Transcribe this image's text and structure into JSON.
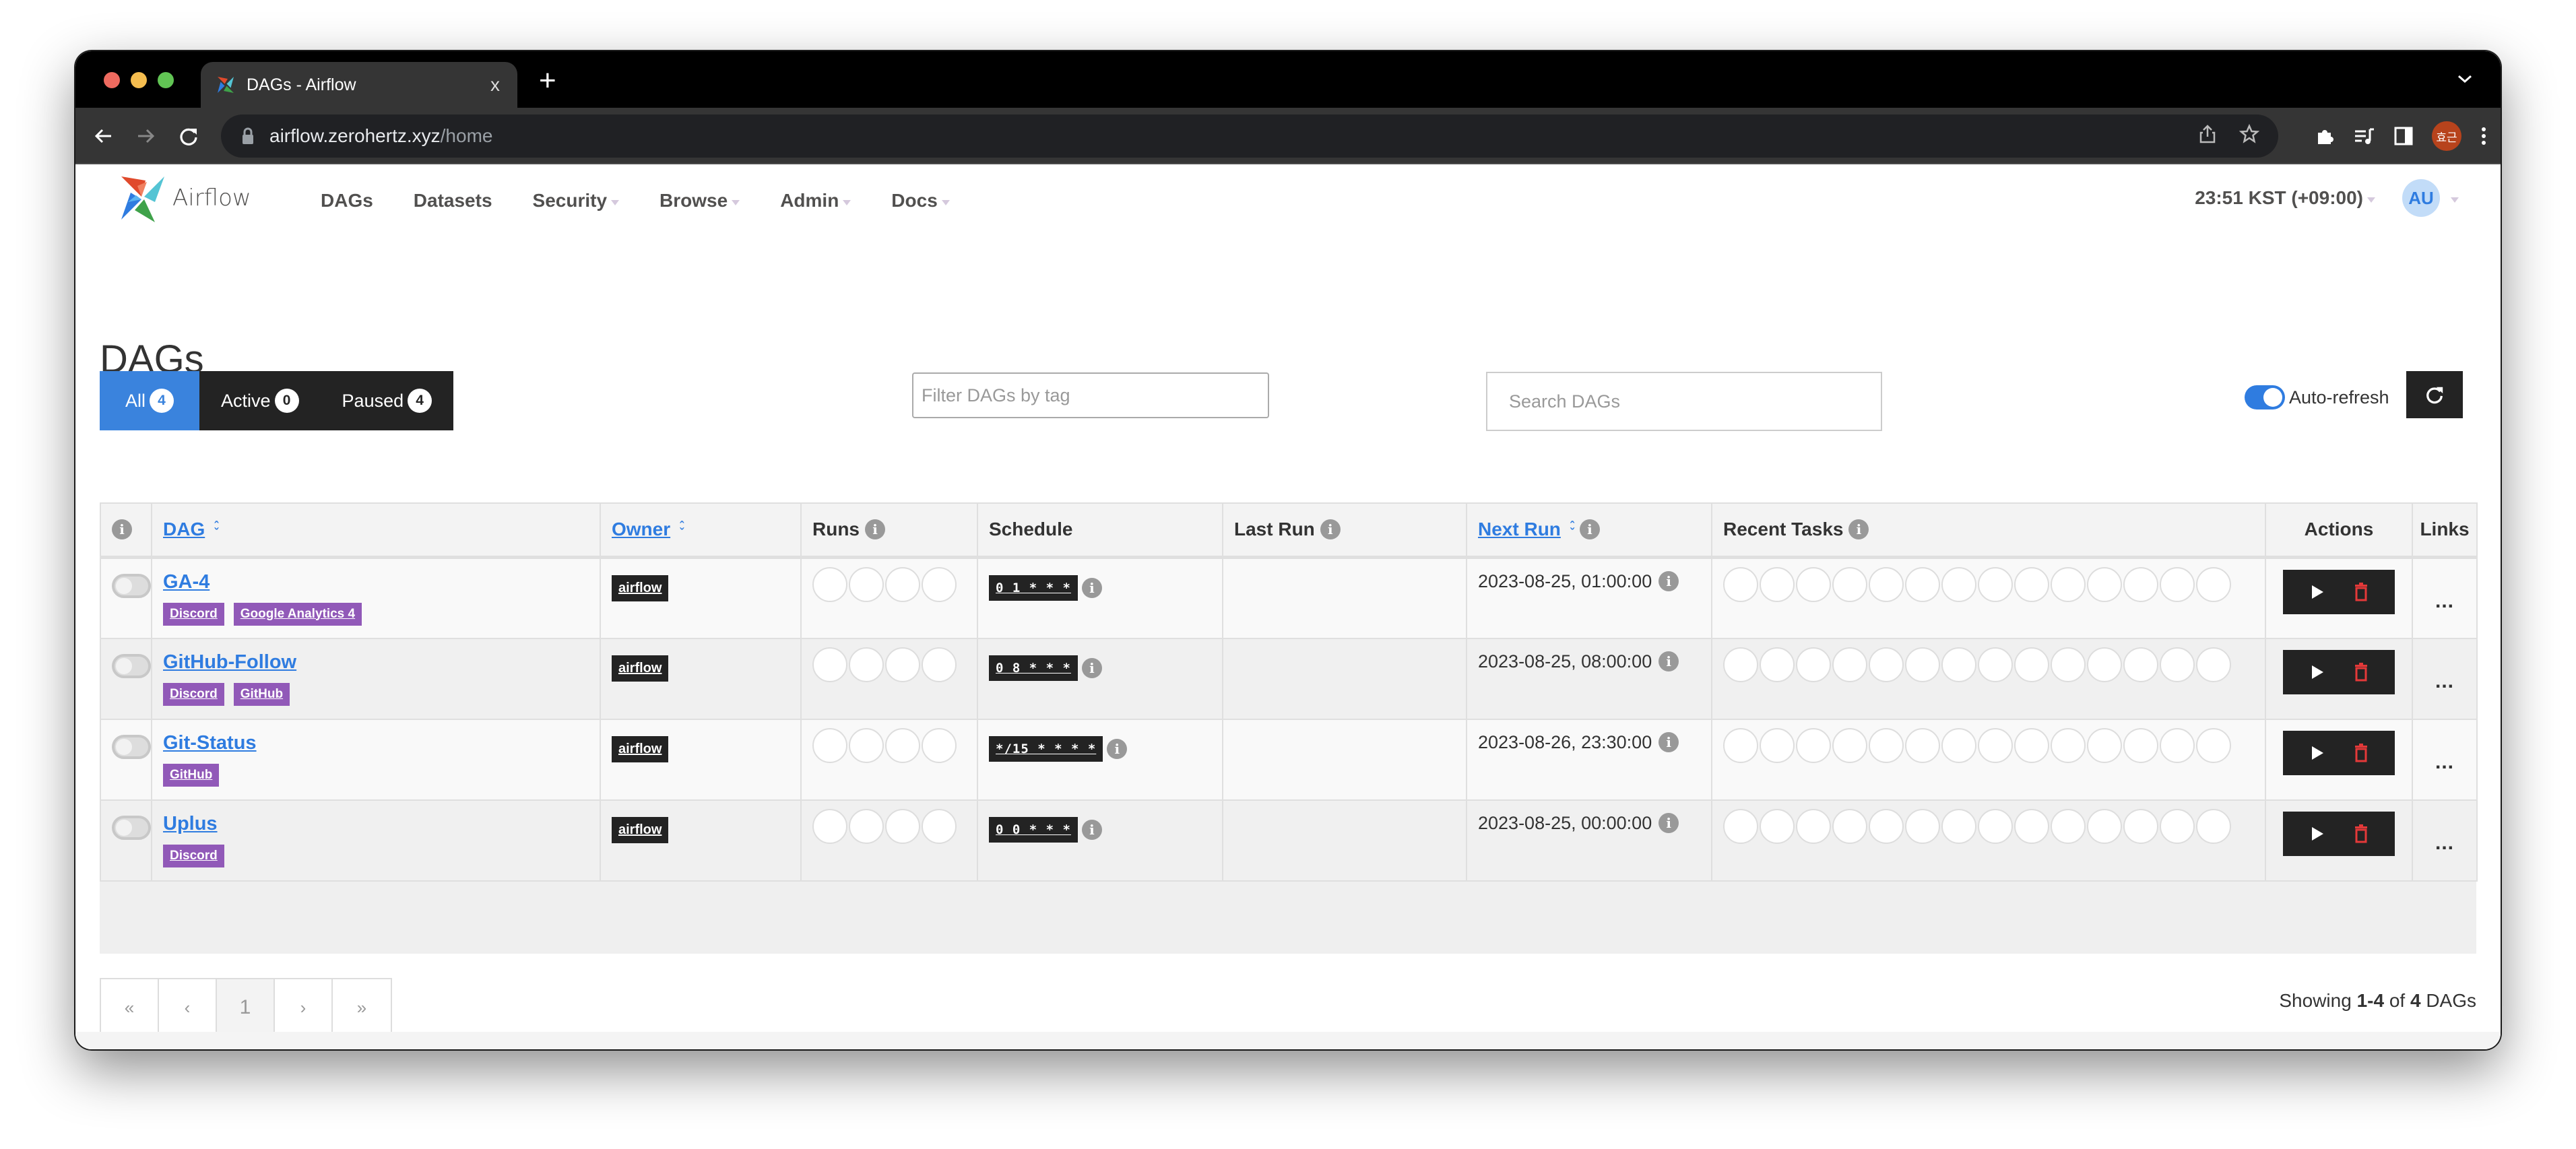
{
  "browser": {
    "tab_title": "DAGs - Airflow",
    "tab_close": "x",
    "new_tab": "+",
    "url_host": "airflow.zerohertz.xyz",
    "url_path": "/home",
    "profile_initials": "효근"
  },
  "nav": {
    "brand": "Airflow",
    "items": [
      {
        "label": "DAGs",
        "dropdown": false
      },
      {
        "label": "Datasets",
        "dropdown": false
      },
      {
        "label": "Security",
        "dropdown": true
      },
      {
        "label": "Browse",
        "dropdown": true
      },
      {
        "label": "Admin",
        "dropdown": true
      },
      {
        "label": "Docs",
        "dropdown": true
      }
    ],
    "clock": "23:51 KST (+09:00)",
    "user_initials": "AU"
  },
  "page": {
    "title": "DAGs",
    "status_tabs": [
      {
        "label": "All",
        "count": "4",
        "active": true
      },
      {
        "label": "Active",
        "count": "0",
        "active": false
      },
      {
        "label": "Paused",
        "count": "4",
        "active": false
      }
    ],
    "tag_filter_placeholder": "Filter DAGs by tag",
    "search_placeholder": "Search DAGs",
    "auto_refresh_label": "Auto-refresh",
    "auto_refresh_on": true
  },
  "table": {
    "headers": {
      "dag": "DAG",
      "owner": "Owner",
      "runs": "Runs",
      "schedule": "Schedule",
      "last_run": "Last Run",
      "next_run": "Next Run",
      "recent_tasks": "Recent Tasks",
      "actions": "Actions",
      "links": "Links"
    },
    "links_glyph": "...",
    "rows": [
      {
        "dag_id": "GA-4",
        "tags": [
          "Discord",
          "Google Analytics 4"
        ],
        "owner": "airflow",
        "schedule": "0 1 * * *",
        "last_run": "",
        "next_run": "2023-08-25, 01:00:00",
        "paused": true
      },
      {
        "dag_id": "GitHub-Follow",
        "tags": [
          "Discord",
          "GitHub"
        ],
        "owner": "airflow",
        "schedule": "0 8 * * *",
        "last_run": "",
        "next_run": "2023-08-25, 08:00:00",
        "paused": true
      },
      {
        "dag_id": "Git-Status",
        "tags": [
          "GitHub"
        ],
        "owner": "airflow",
        "schedule": "*/15 * * * *",
        "last_run": "",
        "next_run": "2023-08-26, 23:30:00",
        "paused": true
      },
      {
        "dag_id": "Uplus",
        "tags": [
          "Discord"
        ],
        "owner": "airflow",
        "schedule": "0 0 * * *",
        "last_run": "",
        "next_run": "2023-08-25, 00:00:00",
        "paused": true
      }
    ],
    "runs_circles": 4,
    "recent_task_circles": 14
  },
  "pagination": {
    "first": "«",
    "prev": "‹",
    "current": "1",
    "next": "›",
    "last": "»"
  },
  "summary": {
    "prefix": "Showing",
    "range": "1-4",
    "middle": "of",
    "total": "4",
    "suffix": "DAGs"
  }
}
